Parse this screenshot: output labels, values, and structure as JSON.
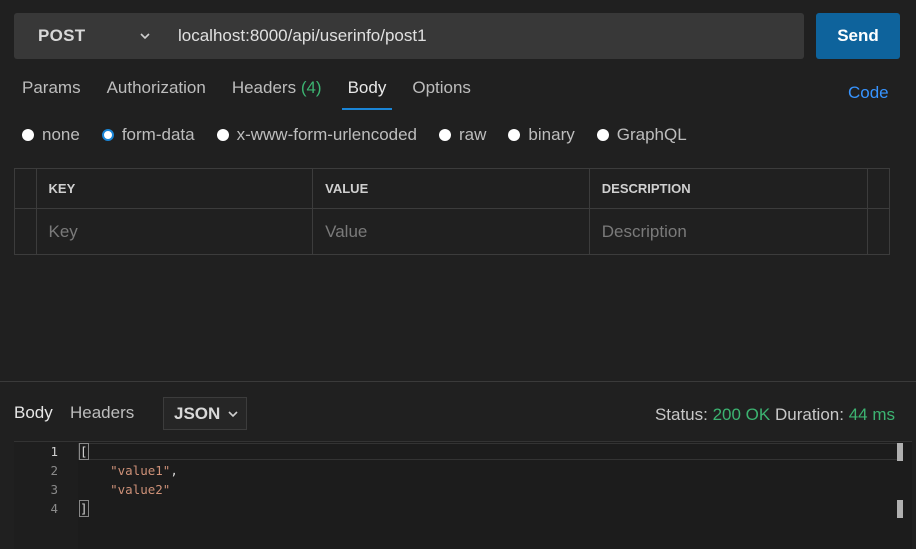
{
  "request": {
    "method": "POST",
    "url": "localhost:8000/api/userinfo/post1",
    "send_label": "Send"
  },
  "tabs": [
    {
      "label": "Params"
    },
    {
      "label": "Authorization"
    },
    {
      "label": "Headers",
      "count": "(4)"
    },
    {
      "label": "Body"
    },
    {
      "label": "Options"
    }
  ],
  "code_link": "Code",
  "body_types": [
    {
      "label": "none"
    },
    {
      "label": "form-data"
    },
    {
      "label": "x-www-form-urlencoded"
    },
    {
      "label": "raw"
    },
    {
      "label": "binary"
    },
    {
      "label": "GraphQL"
    }
  ],
  "form_table": {
    "headers": [
      "KEY",
      "VALUE",
      "DESCRIPTION"
    ],
    "placeholders": {
      "key": "Key",
      "value": "Value",
      "description": "Description"
    }
  },
  "response": {
    "tabs": [
      "Body",
      "Headers"
    ],
    "format": "JSON",
    "status_label": "Status:",
    "status_value": "200 OK",
    "duration_label": "Duration:",
    "duration_value": "44 ms",
    "line_numbers": [
      "1",
      "2",
      "3",
      "4"
    ],
    "lines": [
      "[",
      "\"value1\"",
      "\"value2\"",
      "]"
    ]
  },
  "colors": {
    "accent": "#1a85d6",
    "send": "#0e639c",
    "ok": "#3cb371",
    "string": "#ce9178"
  }
}
